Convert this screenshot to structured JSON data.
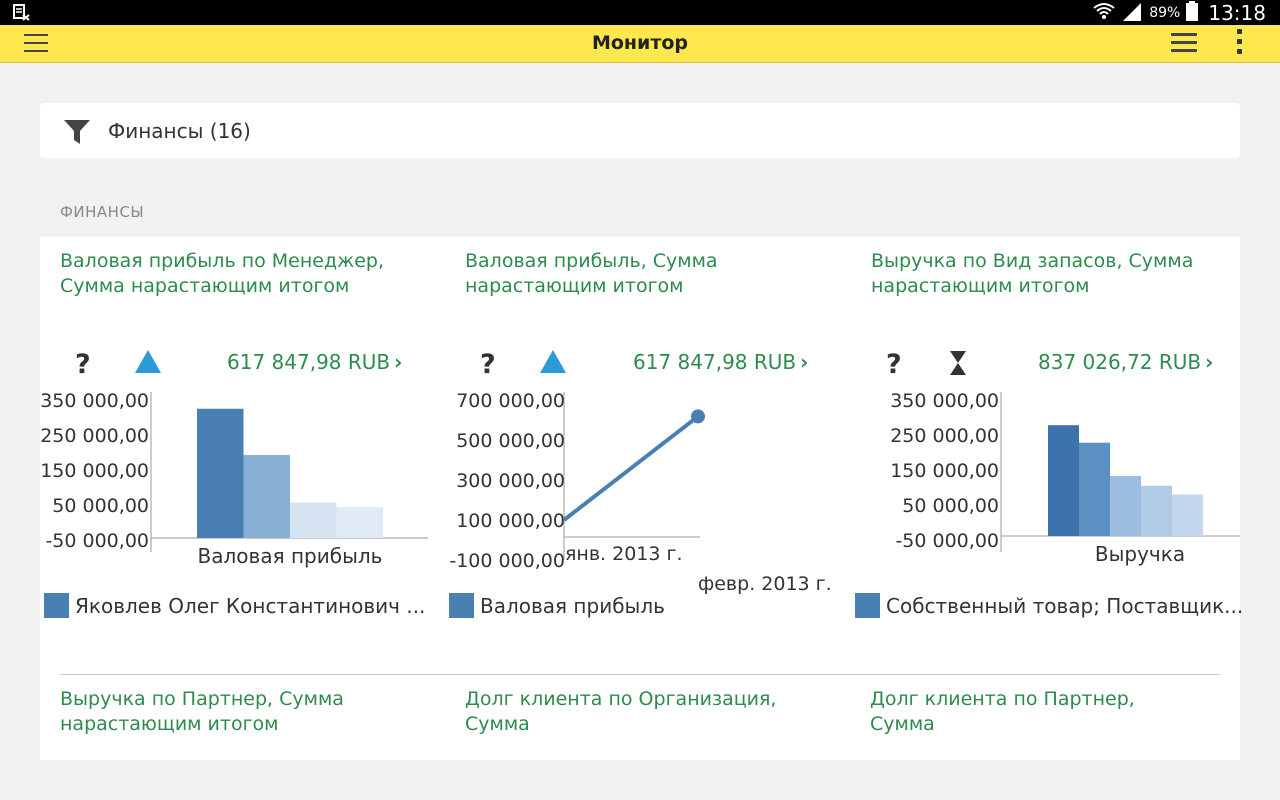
{
  "status_bar": {
    "battery": "89%",
    "time": "13:18"
  },
  "app_bar": {
    "title": "Монитор"
  },
  "filter": {
    "label": "Финансы (16)"
  },
  "section": {
    "title": "ФИНАНСЫ"
  },
  "cards": [
    {
      "title": "Валовая прибыль по Менеджер, Сумма нарастающим итогом",
      "value": "617 847,98 RUB",
      "trend_icon": "triangle-up-icon",
      "legend": "Яковлев Олег Константинович ...",
      "chart_data": {
        "type": "bar",
        "yticks": [
          "350 000,00",
          "250 000,00",
          "150 000,00",
          "50 000,00",
          "-50 000,00"
        ],
        "ylim": [
          -50000,
          350000
        ],
        "categories": [
          "Валовая прибыль"
        ],
        "values": [
          325000,
          193000,
          57000,
          44000
        ],
        "colors": [
          "#4a7fb4",
          "#88afd6",
          "#d6e4f1",
          "#e0eaf4"
        ]
      }
    },
    {
      "title": "Валовая прибыль, Сумма нарастающим итогом",
      "value": "617 847,98 RUB",
      "trend_icon": "triangle-up-icon",
      "legend": "Валовая прибыль",
      "chart_data": {
        "type": "line",
        "yticks": [
          "700 000,00",
          "500 000,00",
          "300 000,00",
          "100 000,00",
          "-100 000,00"
        ],
        "ylim": [
          -100000,
          700000
        ],
        "x": [
          "янв. 2013 г.",
          "февр. 2013 г."
        ],
        "values": [
          100000,
          617847.98
        ],
        "colors": [
          "#4a7fb4"
        ]
      }
    },
    {
      "title": "Выручка по Вид запасов, Сумма нарастающим итогом",
      "value": "837 026,72 RUB",
      "trend_icon": "hourglass-icon",
      "legend": "Собственный товар; Поставщик...",
      "chart_data": {
        "type": "bar",
        "yticks": [
          "350 000,00",
          "250 000,00",
          "150 000,00",
          "50 000,00",
          "-50 000,00"
        ],
        "ylim": [
          -50000,
          350000
        ],
        "categories": [
          "Выручка"
        ],
        "values": [
          278000,
          228000,
          133000,
          105000,
          80000
        ],
        "colors": [
          "#3d73ad",
          "#5c8fc2",
          "#9dbde0",
          "#b0cbe6",
          "#c3d8ee"
        ]
      }
    }
  ],
  "bottom_cards": [
    {
      "title": "Выручка по Партнер, Сумма нарастающим итогом"
    },
    {
      "title": "Долг клиента по Организация, Сумма"
    },
    {
      "title": "Долг клиента по Партнер, Сумма"
    }
  ]
}
